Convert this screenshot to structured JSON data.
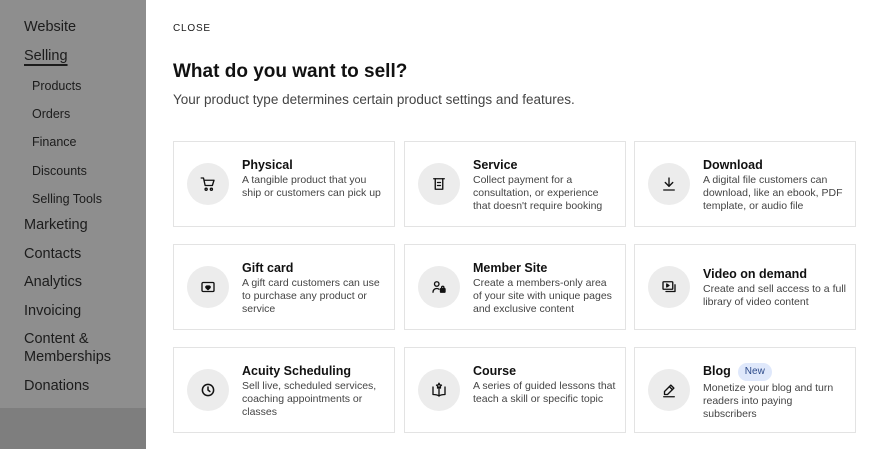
{
  "sidebar": {
    "items": [
      {
        "label": "Website"
      },
      {
        "label": "Selling"
      },
      {
        "label": "Products"
      },
      {
        "label": "Orders"
      },
      {
        "label": "Finance"
      },
      {
        "label": "Discounts"
      },
      {
        "label": "Selling Tools"
      },
      {
        "label": "Marketing"
      },
      {
        "label": "Contacts"
      },
      {
        "label": "Analytics"
      },
      {
        "label": "Invoicing"
      },
      {
        "label": "Content & Memberships"
      },
      {
        "label": "Donations"
      }
    ]
  },
  "panel": {
    "close_label": "CLOSE",
    "title": "What do you want to sell?",
    "subtitle": "Your product type determines certain product settings and features."
  },
  "cards": [
    {
      "title": "Physical",
      "desc": "A tangible product that you ship or customers can pick up",
      "icon": "cart-icon"
    },
    {
      "title": "Service",
      "desc": "Collect payment for a consultation, or experience that doesn't require booking",
      "icon": "receipt-icon"
    },
    {
      "title": "Download",
      "desc": "A digital file customers can download, like an ebook, PDF template, or audio file",
      "icon": "download-icon"
    },
    {
      "title": "Gift card",
      "desc": "A gift card customers can use to purchase any product or service",
      "icon": "gift-card-icon"
    },
    {
      "title": "Member Site",
      "desc": "Create a members-only area of your site with unique pages and exclusive content",
      "icon": "member-lock-icon"
    },
    {
      "title": "Video on demand",
      "desc": "Create and sell access to a full library of video content",
      "icon": "video-library-icon"
    },
    {
      "title": "Acuity Scheduling",
      "desc": "Sell live, scheduled services, coaching appointments or classes",
      "icon": "clock-icon"
    },
    {
      "title": "Course",
      "desc": "A series of guided lessons that teach a skill or specific topic",
      "icon": "open-book-icon"
    },
    {
      "title": "Blog",
      "badge": "New",
      "desc": "Monetize your blog and turn readers into paying subscribers",
      "icon": "pen-icon"
    }
  ]
}
